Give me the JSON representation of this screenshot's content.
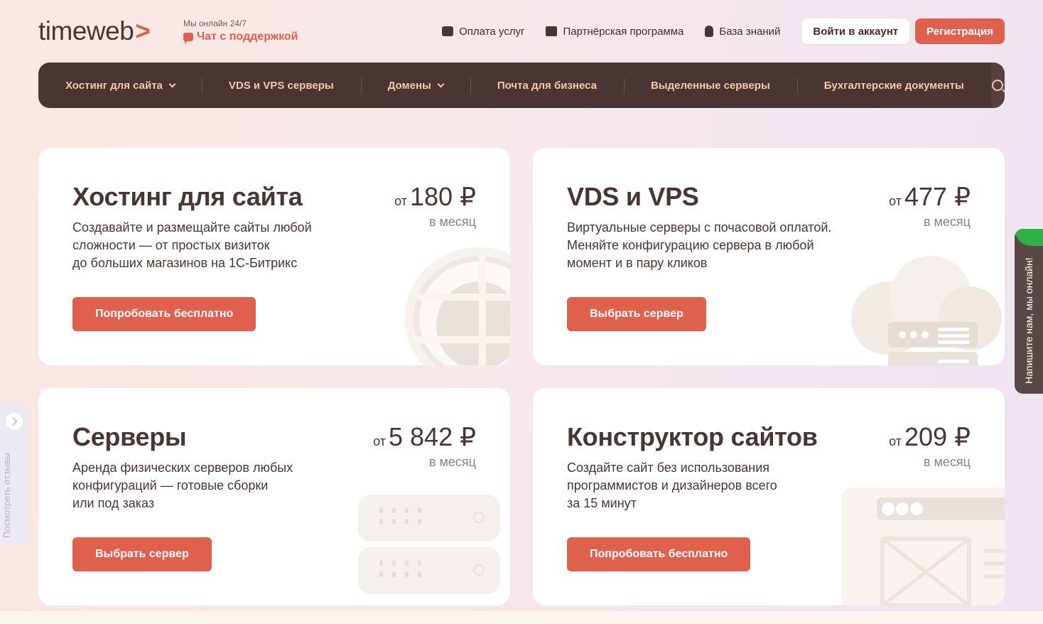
{
  "header": {
    "logo": "timeweb",
    "online_text": "Мы онлайн 24/7",
    "support_chat": "Чат с поддержкой",
    "links": [
      {
        "label": "Оплата услуг",
        "icon": "wallet-icon"
      },
      {
        "label": "Партнёрская программа",
        "icon": "ticket-icon"
      },
      {
        "label": "База знаний",
        "icon": "lightbulb-icon"
      }
    ],
    "login": "Войти в аккаунт",
    "register": "Регистрация"
  },
  "nav": {
    "items": [
      {
        "label": "Хостинг для сайта",
        "dropdown": true
      },
      {
        "label": "VDS и VPS серверы",
        "dropdown": false
      },
      {
        "label": "Домены",
        "dropdown": true
      },
      {
        "label": "Почта для бизнеса",
        "dropdown": false
      },
      {
        "label": "Выделенные серверы",
        "dropdown": false
      },
      {
        "label": "Бухгалтерские документы",
        "dropdown": false
      }
    ]
  },
  "cards": [
    {
      "title": "Хостинг для сайта",
      "description": "Создавайте и размещайте сайты любой\nсложности — от простых визиток\nдо больших магазинов на 1С-Битрикс",
      "price_prefix": "от",
      "price": "180 ₽",
      "period": "в месяц",
      "button": "Попробовать бесплатно",
      "illustration": "globe-icon"
    },
    {
      "title": "VDS и VPS",
      "description": "Виртуальные серверы с почасовой оплатой.\nМеняйте конфигурацию сервера в любой\nмомент и в пару кликов",
      "price_prefix": "от",
      "price": "477 ₽",
      "period": "в месяц",
      "button": "Выбрать сервер",
      "illustration": "cloud-server-icon"
    },
    {
      "title": "Серверы",
      "description": "Аренда физических серверов любых\nконфигураций — готовые сборки\nили под заказ",
      "price_prefix": "от",
      "price": "5 842 ₽",
      "period": "в месяц",
      "button": "Выбрать сервер",
      "illustration": "server-rack-icon"
    },
    {
      "title": "Конструктор сайтов",
      "description": "Создайте сайт без использования\nпрограммистов и дизайнеров всего\nза 15 минут",
      "price_prefix": "от",
      "price": "209 ₽",
      "period": "в месяц",
      "button": "Попробовать бесплатно",
      "illustration": "browser-window-icon"
    }
  ],
  "side_tab": {
    "label": "Посмотреть отзывы"
  },
  "chat_widget": {
    "label": "Напишите нам, мы онлайн!"
  },
  "colors": {
    "accent": "#e0604e",
    "dark": "#4a3534",
    "nav_text": "#f3c9a8",
    "online_green": "#2fb14a"
  }
}
